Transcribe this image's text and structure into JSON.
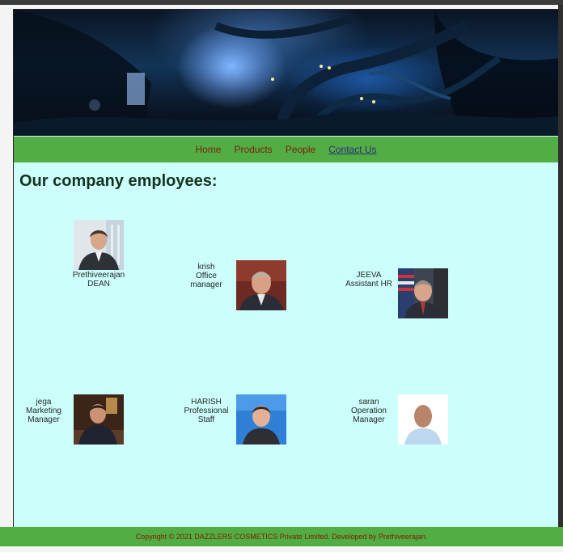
{
  "nav": {
    "links": [
      {
        "label": "Home"
      },
      {
        "label": "Products"
      },
      {
        "label": "People"
      },
      {
        "label": "Contact Us"
      }
    ]
  },
  "main": {
    "heading": "Our company employees:",
    "employees": [
      {
        "name": "Prethiveerajan",
        "role": "DEAN"
      },
      {
        "name": "krish",
        "role": "Office manager"
      },
      {
        "name": "JEEVA",
        "role": "Assistant HR"
      },
      {
        "name": "jega",
        "role": "Marketing Manager"
      },
      {
        "name": "HARISH",
        "role": "Professional Staff"
      },
      {
        "name": "saran",
        "role": "Operation Manager"
      }
    ]
  },
  "footer": {
    "text": "Copyright © 2021 DAZZLERS COSMETICS Private Limited. Developed by Prethiveerajan."
  },
  "colors": {
    "nav_bg": "#53ad45",
    "page_bg": "#ccfffc",
    "link": "#7a1e08",
    "active_link": "#2c2c7a",
    "heading": "#16321e"
  }
}
